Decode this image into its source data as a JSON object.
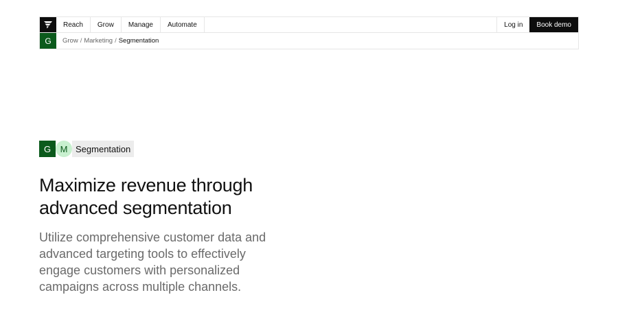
{
  "nav": {
    "logo_icon": "brand-logo-icon",
    "links": [
      "Reach",
      "Grow",
      "Manage",
      "Automate"
    ],
    "login": "Log in",
    "demo": "Book demo"
  },
  "breadcrumb": {
    "badge": "G",
    "items": [
      "Grow",
      "Marketing",
      "Segmentation"
    ],
    "separator": "/"
  },
  "hero": {
    "tag_g": "G",
    "tag_m": "M",
    "tag_label": "Segmentation",
    "headline": "Maximize revenue through advanced segmentation",
    "subtext": "Utilize comprehensive customer data and advanced targeting tools to effectively engage customers with personalized campaigns across multiple channels."
  },
  "colors": {
    "brand_dark": "#0d0d0d",
    "brand_green": "#0b5a1c",
    "mint": "#c8f0cf",
    "tag_bg": "#ececec"
  }
}
